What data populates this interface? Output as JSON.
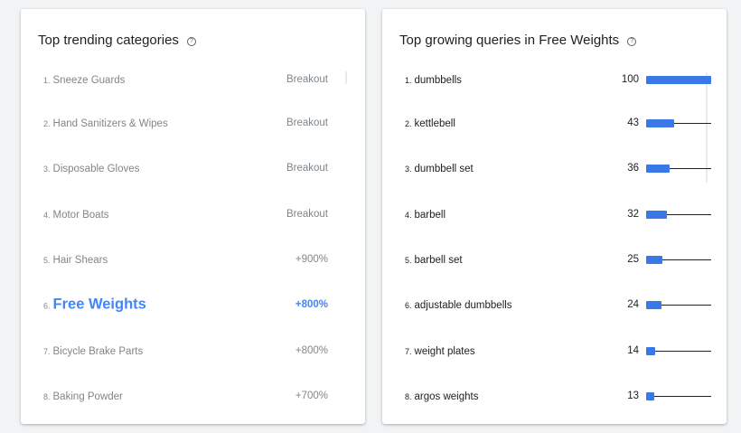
{
  "colors": {
    "accent": "#4285f4",
    "bar": "#3b78e7",
    "muted_text": "#80868b",
    "text": "#202124"
  },
  "left_card": {
    "title": "Top trending categories",
    "help_icon": "help-circle-icon",
    "items": [
      {
        "rank": "1.",
        "name": "Sneeze Guards",
        "value": "Breakout"
      },
      {
        "rank": "2.",
        "name": "Hand Sanitizers & Wipes",
        "value": "Breakout"
      },
      {
        "rank": "3.",
        "name": "Disposable Gloves",
        "value": "Breakout"
      },
      {
        "rank": "4.",
        "name": "Motor Boats",
        "value": "Breakout"
      },
      {
        "rank": "5.",
        "name": "Hair Shears",
        "value": "+900%"
      },
      {
        "rank": "6.",
        "name": "Free Weights",
        "value": "+800%",
        "selected": true
      },
      {
        "rank": "7.",
        "name": "Bicycle Brake Parts",
        "value": "+800%"
      },
      {
        "rank": "8.",
        "name": "Baking Powder",
        "value": "+700%"
      }
    ]
  },
  "right_card": {
    "title": "Top growing queries in Free Weights",
    "help_icon": "help-circle-icon",
    "bar_max": 100,
    "items": [
      {
        "rank": "1.",
        "name": "dumbbells",
        "value": "100",
        "score": 100
      },
      {
        "rank": "2.",
        "name": "kettlebell",
        "value": "43",
        "score": 43
      },
      {
        "rank": "3.",
        "name": "dumbbell set",
        "value": "36",
        "score": 36
      },
      {
        "rank": "4.",
        "name": "barbell",
        "value": "32",
        "score": 32
      },
      {
        "rank": "5.",
        "name": "barbell set",
        "value": "25",
        "score": 25
      },
      {
        "rank": "6.",
        "name": "adjustable dumbbells",
        "value": "24",
        "score": 24
      },
      {
        "rank": "7.",
        "name": "weight plates",
        "value": "14",
        "score": 14
      },
      {
        "rank": "8.",
        "name": "argos weights",
        "value": "13",
        "score": 13
      }
    ]
  }
}
